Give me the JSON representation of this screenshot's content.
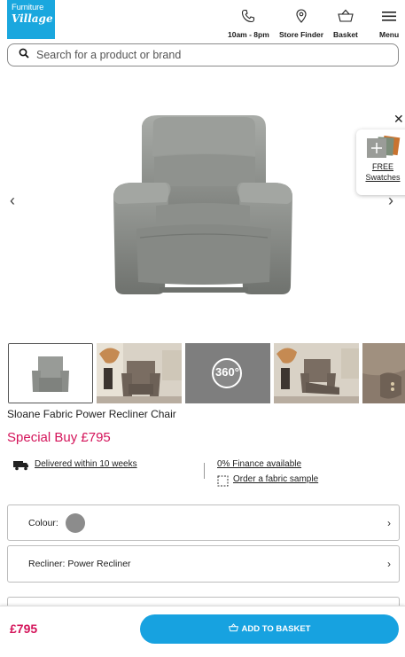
{
  "logo": {
    "line1": "Furniture",
    "line2": "Village"
  },
  "nav": {
    "hours": "10am - 8pm",
    "store_finder": "Store Finder",
    "basket": "Basket",
    "menu": "Menu"
  },
  "search": {
    "placeholder": "Search for a product or brand"
  },
  "swatches": {
    "line1": "FREE",
    "line2": "Swatches"
  },
  "thumbs": {
    "spin_label": "360°"
  },
  "product": {
    "title": "Sloane Fabric Power Recliner Chair",
    "price": "Special Buy £795"
  },
  "info": {
    "delivery": "Delivered within 10 weeks",
    "finance": "0% Finance available",
    "sample": "Order a fabric sample"
  },
  "options": {
    "colour_label": "Colour:",
    "recliner_label": "Recliner: Power Recliner"
  },
  "bottom": {
    "price": "£795",
    "add_to_basket": "ADD TO BASKET"
  },
  "colors": {
    "brand_blue": "#1aa7de",
    "price_pink": "#d4145a",
    "swatch_grey": "#8c8c8c"
  }
}
